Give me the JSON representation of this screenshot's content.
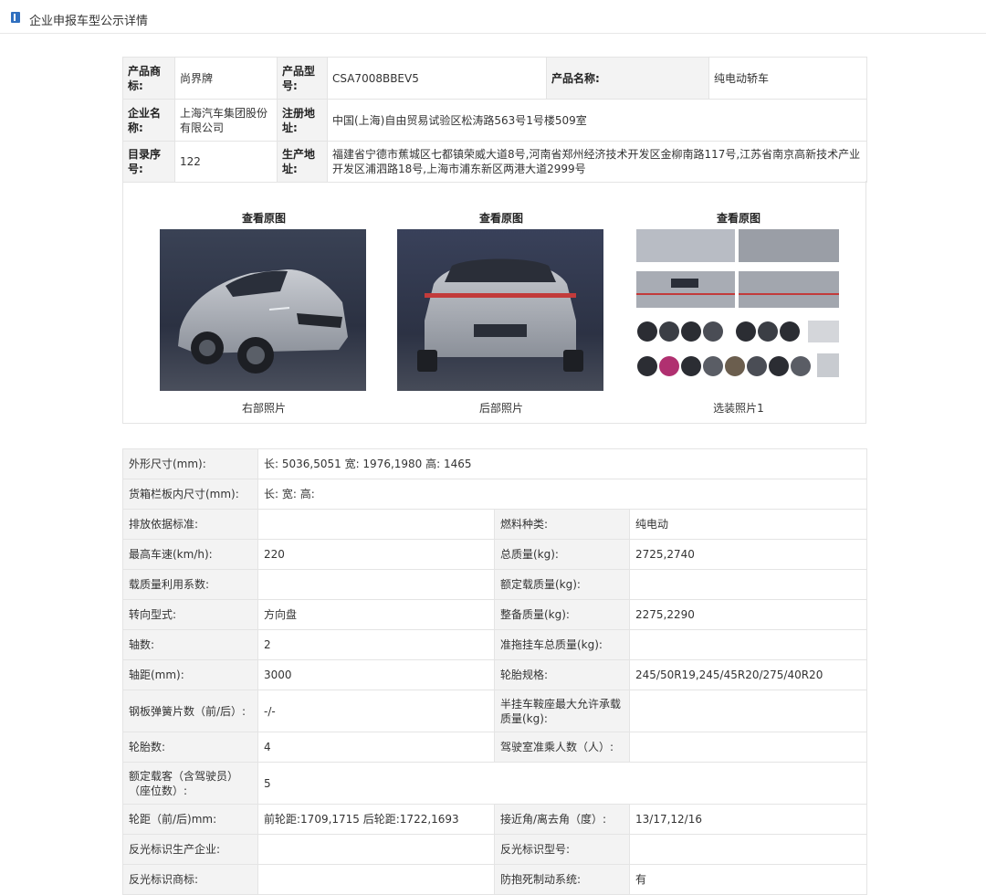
{
  "header": {
    "title": "企业申报车型公示详情"
  },
  "basic": {
    "brand_label": "产品商标:",
    "brand_value": "尚界牌",
    "model_label": "产品型号:",
    "model_value": "CSA7008BBEV5",
    "name_label": "产品名称:",
    "name_value": "纯电动轿车",
    "company_label": "企业名称:",
    "company_value": "上海汽车集团股份有限公司",
    "reg_addr_label": "注册地址:",
    "reg_addr_value": "中国(上海)自由贸易试验区松涛路563号1号楼509室",
    "catalog_label": "目录序号:",
    "catalog_value": "122",
    "prod_addr_label": "生产地址:",
    "prod_addr_value": "福建省宁德市蕉城区七都镇荣威大道8号,河南省郑州经济技术开发区金柳南路117号,江苏省南京高新技术产业开发区浦泗路18号,上海市浦东新区两港大道2999号"
  },
  "photos": [
    {
      "view_label": "查看原图",
      "caption": "右部照片"
    },
    {
      "view_label": "查看原图",
      "caption": "后部照片"
    },
    {
      "view_label": "查看原图",
      "caption": "选装照片1"
    }
  ],
  "specs": {
    "dims_label": "外形尺寸(mm):",
    "dims_value": "长: 5036,5051 宽: 1976,1980 高: 1465",
    "cargo_label": "货箱栏板内尺寸(mm):",
    "cargo_value": "长:  宽:  高:",
    "emission_label": "排放依据标准:",
    "emission_value": "",
    "fuel_label": "燃料种类:",
    "fuel_value": "纯电动",
    "speed_label": "最高车速(km/h):",
    "speed_value": "220",
    "total_mass_label": "总质量(kg):",
    "total_mass_value": "2725,2740",
    "load_coef_label": "载质量利用系数:",
    "load_coef_value": "",
    "rated_load_label": "额定载质量(kg):",
    "rated_load_value": "",
    "steering_label": "转向型式:",
    "steering_value": "方向盘",
    "curb_mass_label": "整备质量(kg):",
    "curb_mass_value": "2275,2290",
    "axles_label": "轴数:",
    "axles_value": "2",
    "trailer_label": "准拖挂车总质量(kg):",
    "trailer_value": "",
    "wheelbase_label": "轴距(mm):",
    "wheelbase_value": "3000",
    "tire_spec_label": "轮胎规格:",
    "tire_spec_value": "245/50R19,245/45R20/275/40R20",
    "spring_label": "钢板弹簧片数（前/后）:",
    "spring_value": "-/-",
    "saddle_label": "半挂车鞍座最大允许承载质量(kg):",
    "saddle_value": "",
    "tires_label": "轮胎数:",
    "tires_value": "4",
    "cab_label": "驾驶室准乘人数（人）:",
    "cab_value": "",
    "passengers_label": "额定载客（含驾驶员）（座位数）:",
    "passengers_value": "5",
    "track_label": "轮距（前/后)mm:",
    "track_value": "前轮距:1709,1715 后轮距:1722,1693",
    "angle_label": "接近角/离去角（度）:",
    "angle_value": "13/17,12/16",
    "reflect_co_label": "反光标识生产企业:",
    "reflect_co_value": "",
    "reflect_model_label": "反光标识型号:",
    "reflect_model_value": "",
    "reflect_brand_label": "反光标识商标:",
    "reflect_brand_value": "",
    "abs_label": "防抱死制动系统:",
    "abs_value": "有"
  }
}
